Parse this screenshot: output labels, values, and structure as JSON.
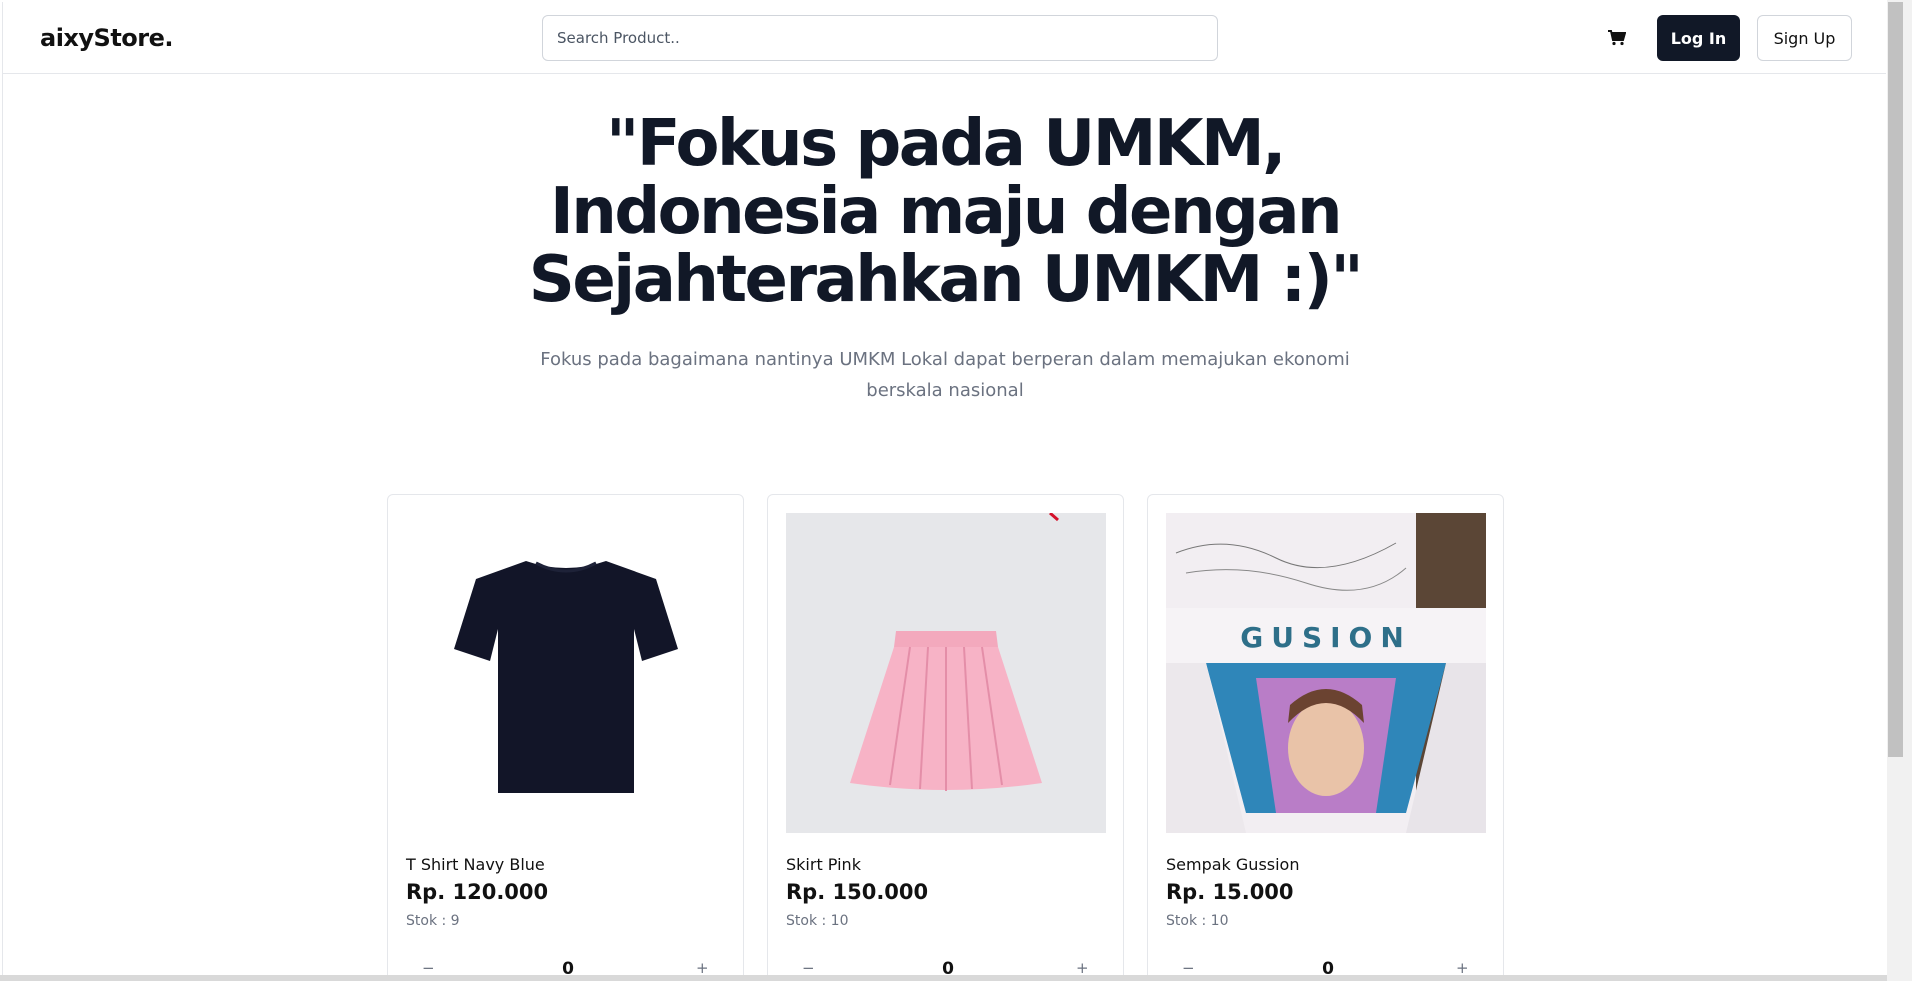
{
  "navbar": {
    "logo": "aixyStore.",
    "search_placeholder": "Search Product..",
    "cart_icon": "cart-icon",
    "login_label": "Log In",
    "signup_label": "Sign Up"
  },
  "hero": {
    "title_line1": "\"Fokus pada UMKM,",
    "title_line2": "Indonesia maju dengan",
    "title_line3": "Sejahterahkan UMKM :)\"",
    "subtitle_line1": "Fokus pada bagaimana nantinya UMKM Lokal dapat berperan dalam memajukan ekonomi",
    "subtitle_line2": "berskala nasional"
  },
  "products": [
    {
      "name": "T Shirt Navy Blue",
      "price": "Rp. 120.000",
      "stock": "Stok : 9",
      "qty": "0",
      "minus": "−",
      "plus": "+"
    },
    {
      "name": "Skirt Pink",
      "price": "Rp. 150.000",
      "stock": "Stok : 10",
      "qty": "0",
      "minus": "−",
      "plus": "+"
    },
    {
      "name": "Sempak Gussion",
      "price": "Rp. 15.000",
      "stock": "Stok : 10",
      "qty": "0",
      "minus": "−",
      "plus": "+"
    }
  ],
  "product_image_text": "GUSION",
  "colors": {
    "primary": "#111827",
    "muted": "#6b7280",
    "border": "#e5e7eb"
  }
}
